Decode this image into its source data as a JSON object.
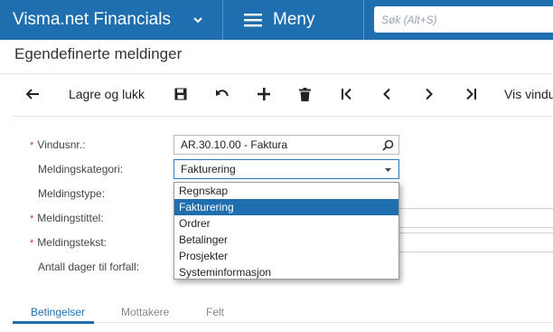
{
  "app": {
    "brand": "Visma.net Financials",
    "menu_label": "Meny",
    "search_placeholder": "Søk (Alt+S)"
  },
  "page": {
    "title": "Egendefinerte meldinger"
  },
  "toolbar": {
    "save_close_label": "Lagre og lukk",
    "view_label": "Vis vindu"
  },
  "form": {
    "window_no": {
      "label": "Vindusnr.:",
      "required": true,
      "value": "AR.30.10.00 - Faktura"
    },
    "category": {
      "label": "Meldingskategori:",
      "value": "Fakturering"
    },
    "type": {
      "label": "Meldingstype:"
    },
    "title": {
      "label": "Meldingstittel:",
      "required": true
    },
    "text": {
      "label": "Meldingstekst:",
      "required": true
    },
    "days_due": {
      "label": "Antall dager til forfall:"
    }
  },
  "dropdown": {
    "options": [
      "Regnskap",
      "Fakturering",
      "Ordrer",
      "Betalinger",
      "Prosjekter",
      "Systeminformasjon"
    ],
    "selected_index": 1
  },
  "tabs": [
    "Betingelser",
    "Mottakere",
    "Felt"
  ],
  "active_tab": 0,
  "colors": {
    "brand_blue": "#1f6fb0",
    "required_red": "#c0392b"
  }
}
